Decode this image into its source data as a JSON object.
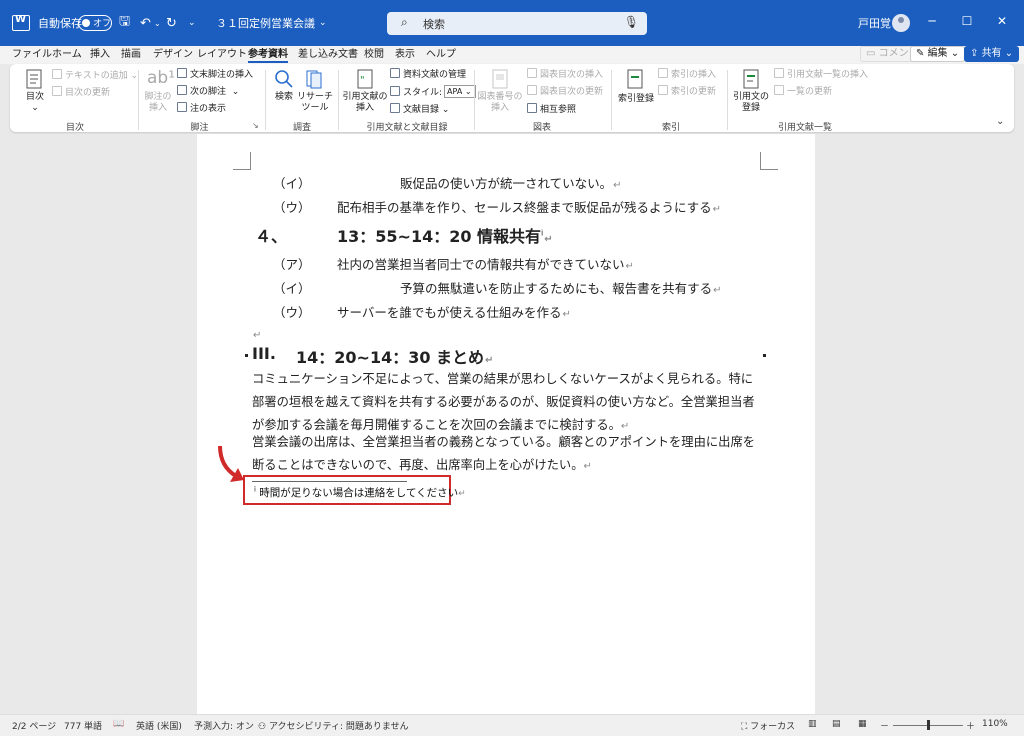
{
  "titlebar": {
    "autosave_label": "自動保存",
    "autosave_state": "オフ",
    "doc_title": "３１回定例営業会議",
    "search_placeholder": "検索",
    "user_name": "戸田覚"
  },
  "menu": {
    "tabs": [
      "ファイル",
      "ホーム",
      "挿入",
      "描画",
      "デザイン",
      "レイアウト",
      "参考資料",
      "差し込み文書",
      "校閲",
      "表示",
      "ヘルプ"
    ],
    "active_tab": "参考資料",
    "comment_label": "コメント",
    "edit_label": "編集",
    "share_label": "共有"
  },
  "ribbon": {
    "groups": {
      "toc": "目次",
      "footnotes": "脚注",
      "research": "調査",
      "citations": "引用文献と文献目録",
      "captions": "図表",
      "index": "索引",
      "toa": "引用文献一覧"
    },
    "toc_btn": "目次",
    "add_text": "テキストの追加",
    "update_toc": "目次の更新",
    "insert_footnote": "脚注の\n挿入",
    "insert_endnote": "文末脚注の挿入",
    "next_footnote": "次の脚注",
    "show_notes": "注の表示",
    "search_btn": "検索",
    "researcher_btn": "リサーチ\nツール",
    "insert_citation": "引用文献の\n挿入",
    "manage_sources": "資料文献の管理",
    "style_label": "スタイル:",
    "style_value": "APA",
    "bibliography": "文献目録",
    "insert_caption": "図表番号の\n挿入",
    "insert_tof": "図表目次の挿入",
    "update_table": "図表目次の更新",
    "cross_ref": "相互参照",
    "mark_entry": "索引登録",
    "insert_index": "索引の挿入",
    "update_index": "索引の更新",
    "mark_citation": "引用文の\n登録",
    "insert_toa": "引用文献一覧の挿入",
    "update_toa": "一覧の更新"
  },
  "document": {
    "lines": [
      {
        "label": "（イ）",
        "text": "販促品の使い方が統一されていない。"
      },
      {
        "label": "（ウ）",
        "text": "配布相手の基準を作り、セールス終盤まで販促品が残るようにする"
      },
      {
        "label": "４、",
        "text": "13：55~14：20 情報共有"
      },
      {
        "label": "（ア）",
        "text": "社内の営業担当者同士での情報共有ができていない"
      },
      {
        "label": "（イ）",
        "text": "予算の無駄遣いを防止するためにも、報告書を共有する"
      },
      {
        "label": "（ウ）",
        "text": "サーバーを誰でもが使える仕組みを作る"
      }
    ],
    "heading3": {
      "label": "III.",
      "text": "14：20~14：30 まとめ"
    },
    "para1": "コミュニケーション不足によって、営業の結果が思わしくないケースがよく見られる。特に部署の垣根を越えて資料を共有する必要があるのが、販促資料の使い方など。全営業担当者が参加する会議を毎月開催することを次回の会議までに検討する。",
    "para2": "営業会議の出席は、全営業担当者の義務となっている。顧客とのアポイントを理由に出席を断ることはできないので、再度、出席率向上を心がけたい。",
    "footnote_mark": "i",
    "footnote": "時間が足りない場合は連絡をしてください",
    "para_mark": "↵"
  },
  "status": {
    "page": "2/2 ページ",
    "words": "777 単語",
    "language": "英語 (米国)",
    "predict": "予測入力: オン",
    "accessibility": "アクセシビリティ: 問題ありません",
    "focus": "フォーカス",
    "zoom": "110%"
  },
  "colors": {
    "accent": "#1b5ebf",
    "highlight_box": "#d12a2a"
  }
}
